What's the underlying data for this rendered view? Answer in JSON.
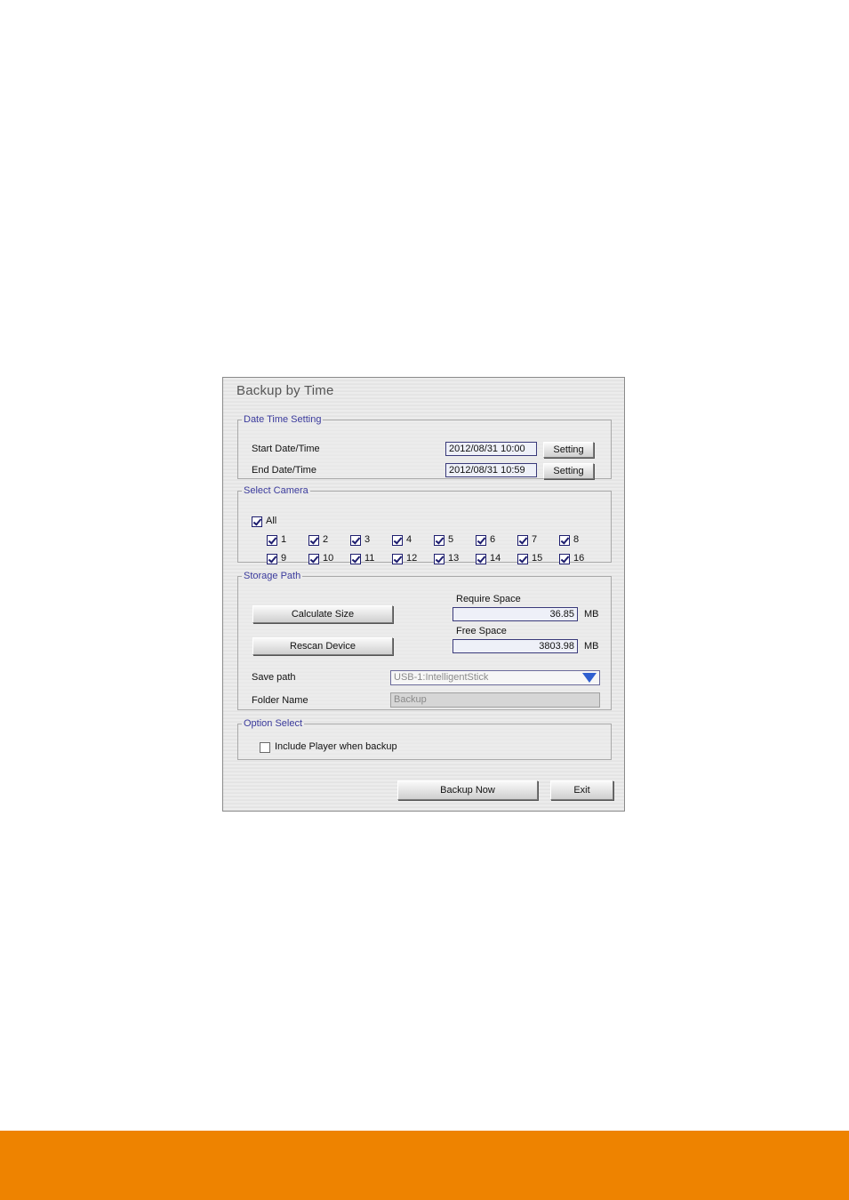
{
  "dialog": {
    "title": "Backup by  Time",
    "date_time": {
      "legend": "Date Time Setting",
      "start_label": "Start Date/Time",
      "start_value": "2012/08/31  10:00",
      "end_label": "End Date/Time",
      "end_value": "2012/08/31  10:59",
      "setting_label": "Setting"
    },
    "camera": {
      "legend": "Select Camera",
      "all_label": "All",
      "all_checked": true,
      "cameras": [
        "1",
        "2",
        "3",
        "4",
        "5",
        "6",
        "7",
        "8",
        "9",
        "10",
        "11",
        "12",
        "13",
        "14",
        "15",
        "16"
      ]
    },
    "storage": {
      "legend": "Storage Path",
      "calculate_label": "Calculate Size",
      "rescan_label": "Rescan Device",
      "require_label": "Require Space",
      "require_value": "36.85",
      "free_label": "Free Space",
      "free_value": "3803.98",
      "unit": "MB",
      "save_path_label": "Save path",
      "save_path_value": "USB-1:IntelligentStick",
      "folder_label": "Folder Name",
      "folder_value": "Backup"
    },
    "option": {
      "legend": "Option Select",
      "include_player_label": "Include Player when backup",
      "include_player_checked": false
    },
    "buttons": {
      "backup_now": "Backup Now",
      "exit": "Exit"
    }
  },
  "colors": {
    "footer_bar": "#ee8300",
    "legend_text": "#3a3a9c",
    "dropdown_arrow": "#2f5fd0"
  }
}
